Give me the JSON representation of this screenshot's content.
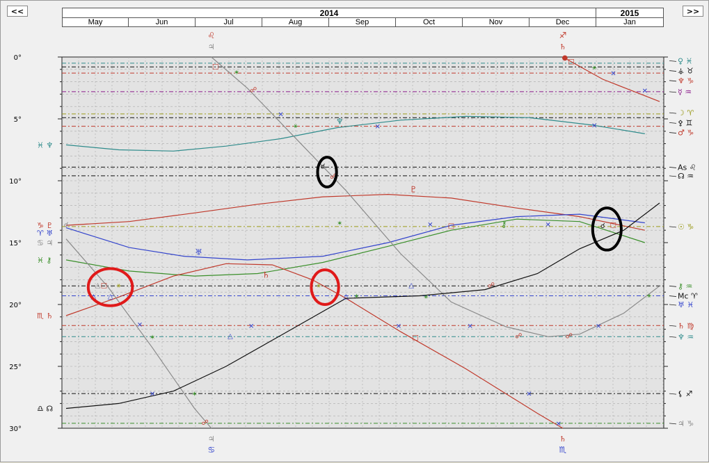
{
  "nav": {
    "prev_label": "<<",
    "next_label": ">>"
  },
  "header": {
    "years": [
      "2014",
      "2015"
    ],
    "months": [
      "May",
      "Jun",
      "Jul",
      "Aug",
      "Sep",
      "Oct",
      "Nov",
      "Dec",
      "Jan"
    ]
  },
  "colors": {
    "plot_bg": "#e3e3e3",
    "border": "#222222",
    "grid": "#a8a8a8",
    "teal": "#2e8b8b",
    "red": "#c0392b",
    "blue": "#3344cc",
    "green": "#3a8f2a",
    "gray": "#8a8a8a",
    "black": "#111111",
    "olive": "#9a9a1a",
    "purple": "#8b1a8b",
    "highlight_red": "#e01a1a",
    "highlight_black": "#000000"
  },
  "chart_data": {
    "type": "line",
    "title": "",
    "xlabel": "",
    "ylabel": "",
    "x_range": [
      "2014-04-23",
      "2015-02-03"
    ],
    "ylim": [
      0,
      30
    ],
    "y_inverted": true,
    "y_ticks": [
      "0°",
      "5°",
      "10°",
      "15°",
      "20°",
      "25°",
      "30°"
    ],
    "x_ticks": [
      "May",
      "Jun",
      "Jul",
      "Aug",
      "Sep",
      "Oct",
      "Nov",
      "Dec",
      "Jan"
    ],
    "grid": true,
    "series": [
      {
        "name": "♆",
        "color_key": "teal",
        "points": [
          [
            "2014-04-25",
            7.1
          ],
          [
            "2014-05-20",
            7.5
          ],
          [
            "2014-06-15",
            7.6
          ],
          [
            "2014-07-10",
            7.2
          ],
          [
            "2014-08-05",
            6.6
          ],
          [
            "2014-09-01",
            5.7
          ],
          [
            "2014-10-01",
            5.1
          ],
          [
            "2014-11-01",
            4.8
          ],
          [
            "2014-12-01",
            4.9
          ],
          [
            "2014-12-31",
            5.5
          ],
          [
            "2015-01-25",
            6.2
          ]
        ]
      },
      {
        "name": "♇",
        "color_key": "red",
        "points": [
          [
            "2014-04-25",
            13.6
          ],
          [
            "2014-05-25",
            13.3
          ],
          [
            "2014-06-25",
            12.6
          ],
          [
            "2014-07-25",
            11.9
          ],
          [
            "2014-08-25",
            11.3
          ],
          [
            "2014-09-25",
            11.1
          ],
          [
            "2014-10-25",
            11.4
          ],
          [
            "2014-11-25",
            12.2
          ],
          [
            "2014-12-25",
            12.9
          ],
          [
            "2015-01-25",
            14.0
          ]
        ]
      },
      {
        "name": "♅",
        "color_key": "blue",
        "points": [
          [
            "2014-04-25",
            13.8
          ],
          [
            "2014-05-25",
            15.4
          ],
          [
            "2014-06-20",
            16.1
          ],
          [
            "2014-07-20",
            16.4
          ],
          [
            "2014-08-25",
            16.1
          ],
          [
            "2014-09-25",
            15.0
          ],
          [
            "2014-10-25",
            13.6
          ],
          [
            "2014-11-25",
            12.9
          ],
          [
            "2014-12-25",
            12.7
          ],
          [
            "2015-01-25",
            13.4
          ]
        ]
      },
      {
        "name": "⚷",
        "color_key": "green",
        "points": [
          [
            "2014-04-25",
            16.4
          ],
          [
            "2014-05-25",
            17.3
          ],
          [
            "2014-06-25",
            17.7
          ],
          [
            "2014-07-25",
            17.5
          ],
          [
            "2014-08-25",
            16.6
          ],
          [
            "2014-09-25",
            15.3
          ],
          [
            "2014-10-25",
            14.0
          ],
          [
            "2014-11-25",
            13.1
          ],
          [
            "2014-12-25",
            13.3
          ],
          [
            "2015-01-25",
            15.0
          ]
        ]
      },
      {
        "name": "♄",
        "color_key": "red",
        "points": [
          [
            "2014-04-25",
            20.9
          ],
          [
            "2014-05-20",
            19.4
          ],
          [
            "2014-06-15",
            17.7
          ],
          [
            "2014-07-10",
            16.7
          ],
          [
            "2014-08-01",
            16.8
          ],
          [
            "2014-08-20",
            18.0
          ],
          [
            "2014-09-05",
            19.5
          ],
          [
            "2014-10-01",
            22.2
          ],
          [
            "2014-11-01",
            25.2
          ],
          [
            "2014-12-05",
            28.8
          ],
          [
            "2014-12-17",
            30.0
          ]
        ]
      },
      {
        "name": "♃",
        "color_key": "gray",
        "points": [
          [
            "2014-04-25",
            14.7
          ],
          [
            "2014-05-15",
            18.6
          ],
          [
            "2014-06-05",
            23.5
          ],
          [
            "2014-06-25",
            28.4
          ],
          [
            "2014-07-03",
            30.0
          ]
        ]
      },
      {
        "name": "♃",
        "color_key": "gray",
        "points": [
          [
            "2014-07-03",
            0.0
          ],
          [
            "2014-07-20",
            2.5
          ],
          [
            "2014-08-10",
            6.2
          ],
          [
            "2014-09-05",
            10.8
          ],
          [
            "2014-10-01",
            15.9
          ],
          [
            "2014-10-25",
            19.8
          ],
          [
            "2014-11-20",
            21.8
          ],
          [
            "2014-12-10",
            22.6
          ],
          [
            "2014-12-25",
            22.4
          ],
          [
            "2015-01-15",
            20.7
          ],
          [
            "2015-02-01",
            18.5
          ]
        ]
      },
      {
        "name": "☊",
        "color_key": "black",
        "points": [
          [
            "2014-04-25",
            28.4
          ],
          [
            "2014-05-20",
            28.0
          ],
          [
            "2014-06-15",
            27.0
          ],
          [
            "2014-07-10",
            25.0
          ],
          [
            "2014-08-05",
            22.5
          ],
          [
            "2014-09-05",
            19.5
          ],
          [
            "2014-10-10",
            19.3
          ],
          [
            "2014-11-10",
            18.8
          ],
          [
            "2014-12-05",
            17.5
          ],
          [
            "2014-12-25",
            15.5
          ],
          [
            "2015-01-15",
            14.0
          ],
          [
            "2015-02-01",
            11.8
          ]
        ]
      },
      {
        "name": "♄",
        "color_key": "red",
        "points": [
          [
            "2014-12-17",
            0.0
          ],
          [
            "2015-01-05",
            1.8
          ],
          [
            "2015-02-01",
            3.6
          ]
        ]
      }
    ],
    "horizontal_lines": [
      {
        "deg": 0.5,
        "color_key": "teal"
      },
      {
        "deg": 0.8,
        "color_key": "black"
      },
      {
        "deg": 1.3,
        "color_key": "red"
      },
      {
        "deg": 2.8,
        "color_key": "purple"
      },
      {
        "deg": 4.6,
        "color_key": "olive"
      },
      {
        "deg": 4.9,
        "color_key": "black"
      },
      {
        "deg": 5.6,
        "color_key": "red"
      },
      {
        "deg": 8.9,
        "color_key": "black"
      },
      {
        "deg": 9.6,
        "color_key": "black"
      },
      {
        "deg": 13.7,
        "color_key": "olive"
      },
      {
        "deg": 18.5,
        "color_key": "black"
      },
      {
        "deg": 19.3,
        "color_key": "blue"
      },
      {
        "deg": 21.7,
        "color_key": "red"
      },
      {
        "deg": 22.6,
        "color_key": "teal"
      },
      {
        "deg": 27.2,
        "color_key": "black"
      },
      {
        "deg": 29.6,
        "color_key": "green"
      }
    ],
    "right_labels": [
      {
        "deg": 0.3,
        "text": "♀ ♓",
        "color_key": "teal"
      },
      {
        "deg": 1.1,
        "text": "⚶ ♉",
        "color_key": "black"
      },
      {
        "deg": 1.9,
        "text": "♆ ♑",
        "color_key": "red"
      },
      {
        "deg": 2.8,
        "text": "☿ ♒",
        "color_key": "purple"
      },
      {
        "deg": 4.5,
        "text": "☽ ♈",
        "color_key": "olive"
      },
      {
        "deg": 5.3,
        "text": "⚴ ♊",
        "color_key": "black"
      },
      {
        "deg": 6.1,
        "text": "♂ ♑",
        "color_key": "red"
      },
      {
        "deg": 8.9,
        "text": "As ♌",
        "color_key": "black"
      },
      {
        "deg": 9.6,
        "text": "☊ ♒",
        "color_key": "black"
      },
      {
        "deg": 13.7,
        "text": "☉ ♑",
        "color_key": "olive"
      },
      {
        "deg": 18.5,
        "text": "⚷ ♒",
        "color_key": "green"
      },
      {
        "deg": 19.3,
        "text": "Mc ♈",
        "color_key": "black"
      },
      {
        "deg": 20.0,
        "text": "♅ ♓",
        "color_key": "blue"
      },
      {
        "deg": 21.7,
        "text": "♄ ♍",
        "color_key": "red"
      },
      {
        "deg": 22.6,
        "text": "♆ ♒",
        "color_key": "teal"
      },
      {
        "deg": 27.2,
        "text": "⚸ ♐",
        "color_key": "black"
      },
      {
        "deg": 29.6,
        "text": "♃ ♑",
        "color_key": "gray"
      }
    ],
    "left_labels": [
      {
        "deg": 7.1,
        "text": "♓ ♆",
        "color_key": "teal"
      },
      {
        "deg": 13.6,
        "text": "♑ ♇",
        "color_key": "red"
      },
      {
        "deg": 14.2,
        "text": "♈ ♅",
        "color_key": "blue"
      },
      {
        "deg": 15.0,
        "text": "♋ ♃",
        "color_key": "gray"
      },
      {
        "deg": 16.4,
        "text": "♓ ⚷",
        "color_key": "green"
      },
      {
        "deg": 20.9,
        "text": "♏ ♄",
        "color_key": "red"
      },
      {
        "deg": 28.4,
        "text": "♎ ☊",
        "color_key": "black"
      }
    ],
    "top_labels": [
      {
        "date": "2014-07-03",
        "sign": "♌",
        "planet": "♃",
        "sign_color_key": "red",
        "planet_color_key": "gray"
      },
      {
        "date": "2014-12-17",
        "sign": "♐",
        "planet": "♄",
        "sign_color_key": "red",
        "planet_color_key": "red"
      }
    ],
    "bottom_labels": [
      {
        "date": "2014-07-03",
        "sign": "♋",
        "planet": "♃",
        "sign_color_key": "blue",
        "planet_color_key": "gray"
      },
      {
        "date": "2014-12-17",
        "sign": "♏",
        "planet": "♄",
        "sign_color_key": "blue",
        "planet_color_key": "red"
      }
    ],
    "curve_labels": [
      {
        "date": "2014-09-02",
        "deg": 5.2,
        "text": "♆",
        "color_key": "teal"
      },
      {
        "date": "2014-10-07",
        "deg": 10.7,
        "text": "♇",
        "color_key": "red"
      },
      {
        "date": "2014-06-27",
        "deg": 15.8,
        "text": "♅",
        "color_key": "blue"
      },
      {
        "date": "2014-11-19",
        "deg": 13.5,
        "text": "⚷",
        "color_key": "green"
      },
      {
        "date": "2014-07-29",
        "deg": 17.6,
        "text": "♄",
        "color_key": "red"
      }
    ],
    "aspect_marks": [
      {
        "date": "2014-07-05",
        "deg": 0.7,
        "text": "□",
        "color_key": "red"
      },
      {
        "date": "2014-07-15",
        "deg": 1.2,
        "text": "✶",
        "color_key": "green"
      },
      {
        "date": "2014-07-23",
        "deg": 2.6,
        "text": "☍",
        "color_key": "red"
      },
      {
        "date": "2014-08-05",
        "deg": 4.6,
        "text": "✕",
        "color_key": "blue"
      },
      {
        "date": "2014-08-12",
        "deg": 5.5,
        "text": "⚹",
        "color_key": "green"
      },
      {
        "date": "2014-08-25",
        "deg": 8.8,
        "text": "☌",
        "color_key": "black"
      },
      {
        "date": "2014-08-30",
        "deg": 9.6,
        "text": "☍",
        "color_key": "red"
      },
      {
        "date": "2014-09-20",
        "deg": 5.6,
        "text": "✕",
        "color_key": "blue"
      },
      {
        "date": "2014-09-02",
        "deg": 13.4,
        "text": "✶",
        "color_key": "green"
      },
      {
        "date": "2014-10-15",
        "deg": 13.5,
        "text": "✕",
        "color_key": "blue"
      },
      {
        "date": "2014-10-25",
        "deg": 13.6,
        "text": "□",
        "color_key": "red"
      },
      {
        "date": "2014-12-10",
        "deg": 13.5,
        "text": "✕",
        "color_key": "blue"
      },
      {
        "date": "2015-01-05",
        "deg": 13.6,
        "text": "☌",
        "color_key": "black"
      },
      {
        "date": "2015-01-10",
        "deg": 13.5,
        "text": "□",
        "color_key": "red"
      },
      {
        "date": "2014-05-10",
        "deg": 18.4,
        "text": "△",
        "color_key": "gray"
      },
      {
        "date": "2014-05-13",
        "deg": 18.4,
        "text": "□",
        "color_key": "red"
      },
      {
        "date": "2014-05-20",
        "deg": 18.4,
        "text": "⚹",
        "color_key": "olive"
      },
      {
        "date": "2014-05-08",
        "deg": 19.3,
        "text": "△",
        "color_key": "blue"
      },
      {
        "date": "2014-05-16",
        "deg": 19.3,
        "text": "△",
        "color_key": "blue"
      },
      {
        "date": "2014-08-23",
        "deg": 18.4,
        "text": "⚹",
        "color_key": "olive"
      },
      {
        "date": "2014-09-05",
        "deg": 19.3,
        "text": "△",
        "color_key": "blue"
      },
      {
        "date": "2014-09-10",
        "deg": 19.3,
        "text": "✶",
        "color_key": "green"
      },
      {
        "date": "2014-10-06",
        "deg": 18.4,
        "text": "△",
        "color_key": "blue"
      },
      {
        "date": "2014-10-13",
        "deg": 19.3,
        "text": "⚹",
        "color_key": "green"
      },
      {
        "date": "2014-11-13",
        "deg": 18.4,
        "text": "☍",
        "color_key": "red"
      },
      {
        "date": "2014-09-30",
        "deg": 21.7,
        "text": "✕",
        "color_key": "blue"
      },
      {
        "date": "2014-10-08",
        "deg": 22.6,
        "text": "□",
        "color_key": "red"
      },
      {
        "date": "2014-11-03",
        "deg": 21.7,
        "text": "✕",
        "color_key": "blue"
      },
      {
        "date": "2014-11-26",
        "deg": 22.5,
        "text": "☍",
        "color_key": "red"
      },
      {
        "date": "2014-12-20",
        "deg": 22.5,
        "text": "☍",
        "color_key": "red"
      },
      {
        "date": "2015-01-03",
        "deg": 21.7,
        "text": "✕",
        "color_key": "blue"
      },
      {
        "date": "2015-01-27",
        "deg": 19.2,
        "text": "⚹",
        "color_key": "green"
      },
      {
        "date": "2014-07-22",
        "deg": 21.7,
        "text": "✕",
        "color_key": "blue"
      },
      {
        "date": "2014-07-12",
        "deg": 22.5,
        "text": "△",
        "color_key": "blue"
      },
      {
        "date": "2014-05-30",
        "deg": 21.6,
        "text": "✕",
        "color_key": "blue"
      },
      {
        "date": "2014-06-05",
        "deg": 22.6,
        "text": "✶",
        "color_key": "green"
      },
      {
        "date": "2014-06-05",
        "deg": 27.2,
        "text": "✕",
        "color_key": "blue"
      },
      {
        "date": "2014-06-25",
        "deg": 27.2,
        "text": "✶",
        "color_key": "green"
      },
      {
        "date": "2014-06-30",
        "deg": 29.5,
        "text": "☍",
        "color_key": "red"
      },
      {
        "date": "2014-12-01",
        "deg": 27.2,
        "text": "✕",
        "color_key": "blue"
      },
      {
        "date": "2014-12-15",
        "deg": 29.6,
        "text": "✕",
        "color_key": "blue"
      },
      {
        "date": "2014-12-18",
        "deg": 0.0,
        "text": "●",
        "color_key": "red"
      },
      {
        "date": "2014-12-21",
        "deg": 0.3,
        "text": "□",
        "color_key": "red"
      },
      {
        "date": "2015-01-01",
        "deg": 0.8,
        "text": "⚹",
        "color_key": "green"
      },
      {
        "date": "2015-01-10",
        "deg": 1.3,
        "text": "✕",
        "color_key": "blue"
      },
      {
        "date": "2015-01-25",
        "deg": 2.7,
        "text": "✕",
        "color_key": "blue"
      },
      {
        "date": "2015-01-01",
        "deg": 5.5,
        "text": "✕",
        "color_key": "blue"
      },
      {
        "date": "2014-04-25",
        "deg": 13.5,
        "text": "☌",
        "color_key": "gray"
      }
    ],
    "highlights": [
      {
        "shape": "ellipse",
        "color_key": "highlight_red",
        "date": "2014-05-16",
        "deg": 18.6,
        "rx_days": 10.5,
        "ry_deg": 1.5
      },
      {
        "shape": "ellipse",
        "color_key": "highlight_red",
        "date": "2014-08-26",
        "deg": 18.6,
        "rx_days": 6.5,
        "ry_deg": 1.4
      },
      {
        "shape": "circle",
        "color_key": "highlight_black",
        "date": "2014-08-27",
        "deg": 9.3,
        "rx_days": 4.5,
        "ry_deg": 1.2
      },
      {
        "shape": "circle",
        "color_key": "highlight_black",
        "date": "2015-01-07",
        "deg": 13.9,
        "rx_days": 6.8,
        "ry_deg": 1.7
      }
    ]
  }
}
